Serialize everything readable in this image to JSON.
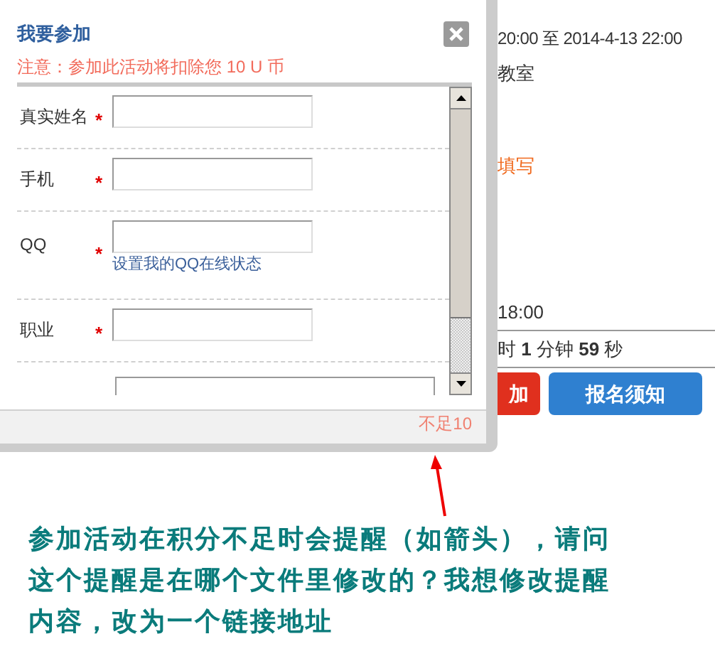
{
  "dialog": {
    "title": "我要参加",
    "notice": "注意：参加此活动将扣除您 10 U 币",
    "fields": [
      {
        "label": "真实姓名",
        "required_mark": "*"
      },
      {
        "label": "手机",
        "required_mark": "*"
      },
      {
        "label": "QQ",
        "required_mark": "*",
        "hint": "设置我的QQ在线状态"
      },
      {
        "label": "职业",
        "required_mark": "*"
      }
    ],
    "footer_message": "不足10"
  },
  "page": {
    "time_range": "20:00 至 2014-4-13 22:00",
    "location": "教室",
    "fill_link": "填写",
    "end_time": "18:00",
    "countdown": "时 **1** 分钟 **59** 秒",
    "buttons": [
      {
        "label": "加",
        "kind": "primary"
      },
      {
        "label": "报名须知",
        "kind": "secondary"
      }
    ]
  },
  "annotation": {
    "text": "参加活动在积分不足时会提醒（如箭头），请问这个提醒是在哪个文件里修改的？我想修改提醒内容，改为一个链接地址"
  }
}
